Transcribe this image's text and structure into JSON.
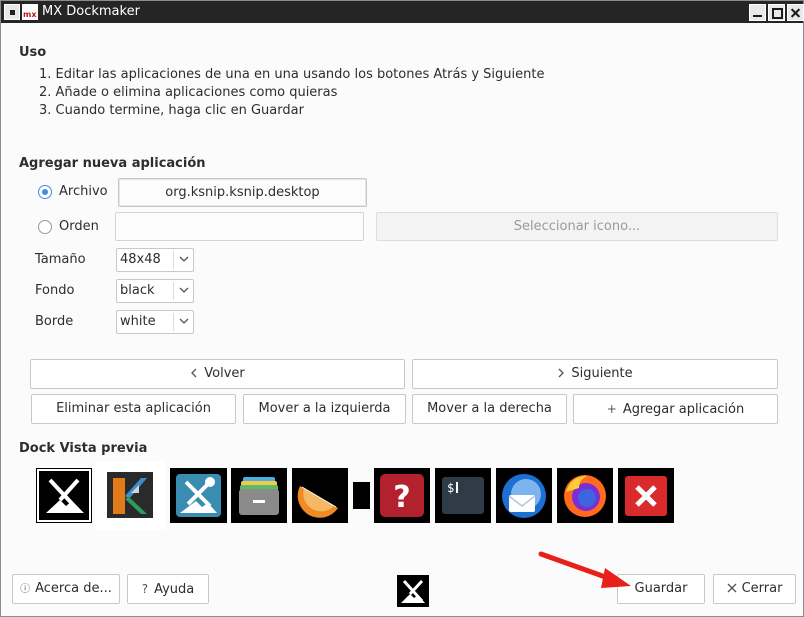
{
  "window": {
    "title": "MX Dockmaker"
  },
  "usage": {
    "heading": "Uso",
    "steps": [
      "1. Editar las aplicaciones de una en una usando los botones Atrás y Siguiente",
      "2. Añade o elimina aplicaciones como quieras",
      "3. Cuando termine, haga clic en Guardar"
    ]
  },
  "add_app": {
    "heading": "Agregar nueva aplicación",
    "file_label": "Archivo",
    "file_value": "org.ksnip.ksnip.desktop",
    "command_label": "Orden",
    "command_value": "",
    "select_icon_label": "Seleccionar icono...",
    "size_label": "Tamaño",
    "size_value": "48x48",
    "background_label": "Fondo",
    "background_value": "black",
    "border_label": "Borde",
    "border_value": "white"
  },
  "nav": {
    "back_label": "Volver",
    "next_label": "Siguiente",
    "delete_label": "Eliminar esta aplicación",
    "move_left_label": "Mover a la izquierda",
    "move_right_label": "Mover a la derecha",
    "add_label": "Agregar aplicación"
  },
  "preview": {
    "heading": "Dock Vista previa",
    "icons": [
      "mx-tools-icon",
      "ksnip-icon",
      "mx-tweak-icon",
      "archive-manager-icon",
      "clementine-icon",
      "separator-icon",
      "help-icon",
      "terminal-icon",
      "thunderbird-icon",
      "firefox-icon",
      "close-window-icon"
    ]
  },
  "footer": {
    "about_label": "Acerca de...",
    "help_label": "Ayuda",
    "save_label": "Guardar",
    "close_label": "Cerrar"
  },
  "colors": {
    "accent": "#3d8ee0",
    "titlebar": "#252525",
    "arrow": "#e8201a"
  }
}
